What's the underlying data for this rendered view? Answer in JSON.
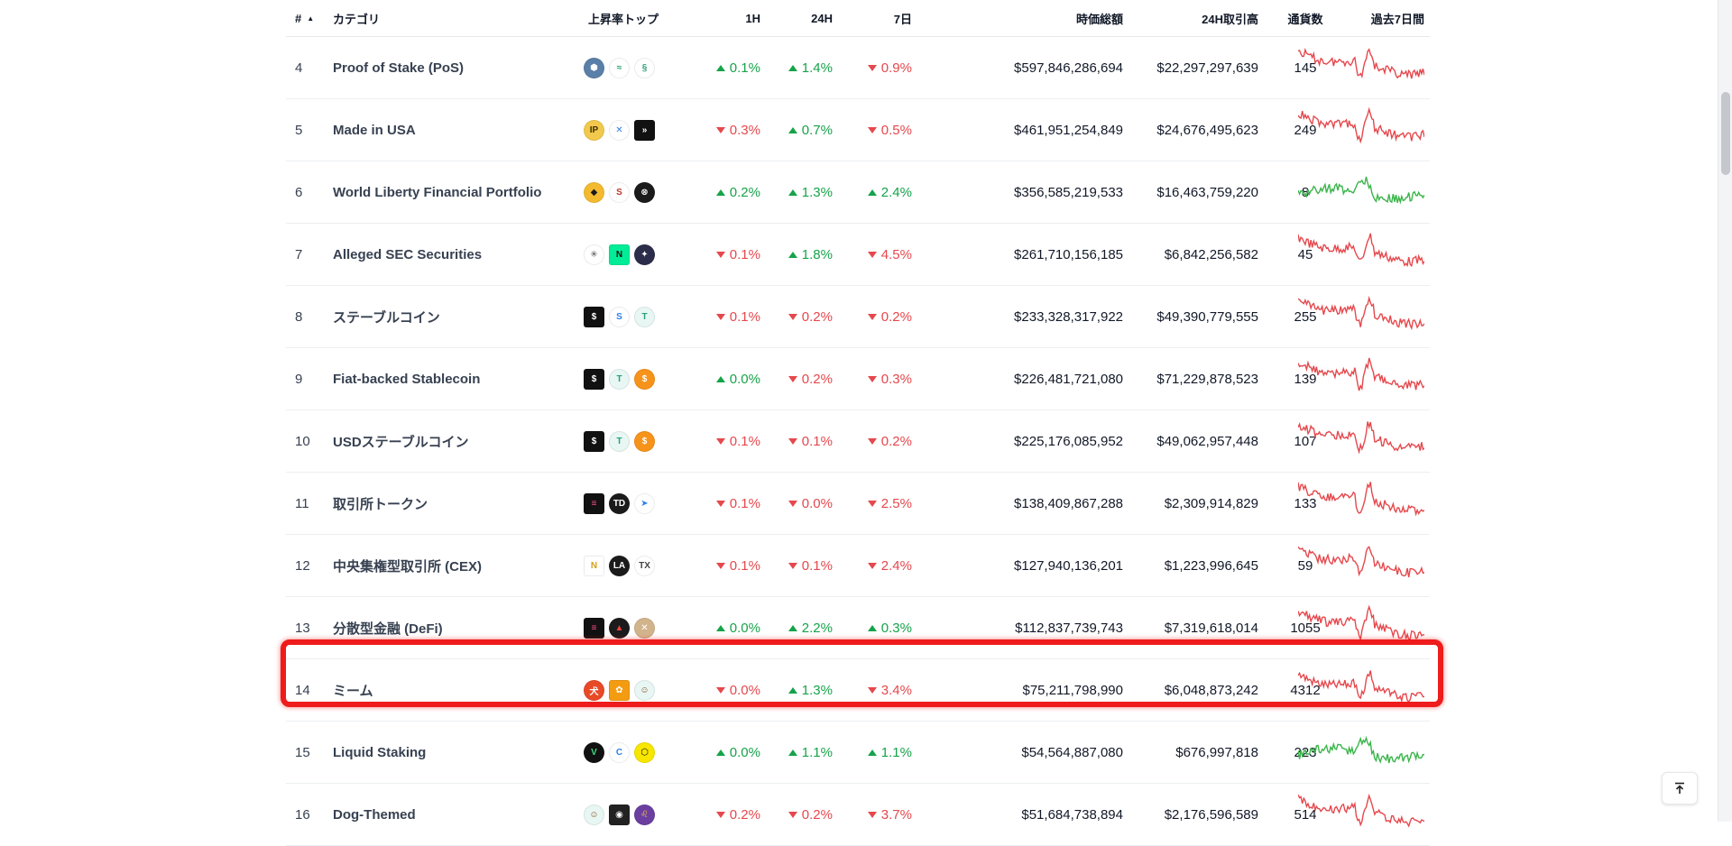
{
  "header": {
    "rank": "#",
    "category": "カテゴリ",
    "top_gainers": "上昇率トップ",
    "h1": "1H",
    "h24": "24H",
    "d7": "7日",
    "market_cap": "時価総額",
    "volume_24h": "24H取引高",
    "coin_count": "通貨数",
    "last_7d": "過去7日間"
  },
  "colors": {
    "up": "#16a34a",
    "down": "#e5484d",
    "highlight": "#ee1c1c"
  },
  "rows": [
    {
      "rank": "4",
      "name": "Proof of Stake (PoS)",
      "h1": "0.1%",
      "h1_dir": "up",
      "h24": "1.4%",
      "h24_dir": "up",
      "d7": "0.9%",
      "d7_dir": "down",
      "mcap": "$597,846,286,694",
      "vol": "$22,297,297,639",
      "count": "145",
      "trend": "down",
      "icons": [
        {
          "name": "cosmos-hub-icon",
          "bg": "#5a7fa8",
          "fg": "#fff",
          "g": "⬢",
          "sq": false
        },
        {
          "name": "leaf-token-icon",
          "bg": "#ffffff",
          "fg": "#22a36c",
          "g": "≈",
          "sq": false
        },
        {
          "name": "link-token-icon",
          "bg": "#ffffff",
          "fg": "#2f9e7a",
          "g": "§",
          "sq": false
        }
      ]
    },
    {
      "rank": "5",
      "name": "Made in USA",
      "h1": "0.3%",
      "h1_dir": "down",
      "h24": "0.7%",
      "h24_dir": "up",
      "d7": "0.5%",
      "d7_dir": "down",
      "mcap": "$461,951,254,849",
      "vol": "$24,676,495,623",
      "count": "249",
      "trend": "down",
      "icons": [
        {
          "name": "ip-token-icon",
          "bg": "#f2c94c",
          "fg": "#3b2f00",
          "g": "IP",
          "sq": false
        },
        {
          "name": "x-token-icon",
          "bg": "#ffffff",
          "fg": "#2f80ed",
          "g": "✕",
          "sq": false
        },
        {
          "name": "arrow-token-icon",
          "bg": "#111111",
          "fg": "#ffffff",
          "g": "»",
          "sq": true
        }
      ]
    },
    {
      "rank": "6",
      "name": "World Liberty Financial Portfolio",
      "h1": "0.2%",
      "h1_dir": "up",
      "h24": "1.3%",
      "h24_dir": "up",
      "d7": "2.4%",
      "d7_dir": "up",
      "mcap": "$356,585,219,533",
      "vol": "$16,463,759,220",
      "count": "8",
      "trend": "up",
      "icons": [
        {
          "name": "bnb-token-icon",
          "bg": "#f3ba2f",
          "fg": "#1a1a1a",
          "g": "◆",
          "sq": false
        },
        {
          "name": "red-swirl-token-icon",
          "bg": "#ffffff",
          "fg": "#c0392b",
          "g": "S",
          "sq": false
        },
        {
          "name": "dark-token-icon",
          "bg": "#1b1b1b",
          "fg": "#ffffff",
          "g": "⊗",
          "sq": false
        }
      ]
    },
    {
      "rank": "7",
      "name": "Alleged SEC Securities",
      "h1": "0.1%",
      "h1_dir": "down",
      "h24": "1.8%",
      "h24_dir": "up",
      "d7": "4.5%",
      "d7_dir": "down",
      "mcap": "$261,710,156,185",
      "vol": "$6,842,256,582",
      "count": "45",
      "trend": "down",
      "icons": [
        {
          "name": "x-pattern-token-icon",
          "bg": "#ffffff",
          "fg": "#555555",
          "g": "✳",
          "sq": false
        },
        {
          "name": "near-token-icon",
          "bg": "#00ec97",
          "fg": "#111111",
          "g": "N",
          "sq": true
        },
        {
          "name": "star-token-icon",
          "bg": "#2b2d4a",
          "fg": "#ffffff",
          "g": "✦",
          "sq": false
        }
      ]
    },
    {
      "rank": "8",
      "name": "ステーブルコイン",
      "h1": "0.1%",
      "h1_dir": "down",
      "h24": "0.2%",
      "h24_dir": "down",
      "d7": "0.2%",
      "d7_dir": "down",
      "mcap": "$233,328,317,922",
      "vol": "$49,390,779,555",
      "count": "255",
      "trend": "down",
      "icons": [
        {
          "name": "dollar-square-token-icon",
          "bg": "#111111",
          "fg": "#ffffff",
          "g": "$",
          "sq": true
        },
        {
          "name": "usd-swirl-token-icon",
          "bg": "#ffffff",
          "fg": "#2f80ed",
          "g": "S",
          "sq": false
        },
        {
          "name": "usdt-token-icon",
          "bg": "#e8f7f3",
          "fg": "#26a17b",
          "g": "T",
          "sq": false
        }
      ]
    },
    {
      "rank": "9",
      "name": "Fiat-backed Stablecoin",
      "h1": "0.0%",
      "h1_dir": "up",
      "h24": "0.2%",
      "h24_dir": "down",
      "d7": "0.3%",
      "d7_dir": "down",
      "mcap": "$226,481,721,080",
      "vol": "$71,229,878,523",
      "count": "139",
      "trend": "down",
      "icons": [
        {
          "name": "dollar-square-token-icon",
          "bg": "#111111",
          "fg": "#ffffff",
          "g": "$",
          "sq": true
        },
        {
          "name": "usdt-token-icon",
          "bg": "#e8f7f3",
          "fg": "#26a17b",
          "g": "T",
          "sq": false
        },
        {
          "name": "orange-dollar-token-icon",
          "bg": "#f7931a",
          "fg": "#ffffff",
          "g": "$",
          "sq": false
        }
      ]
    },
    {
      "rank": "10",
      "name": "USDステーブルコイン",
      "h1": "0.1%",
      "h1_dir": "down",
      "h24": "0.1%",
      "h24_dir": "down",
      "d7": "0.2%",
      "d7_dir": "down",
      "mcap": "$225,176,085,952",
      "vol": "$49,062,957,448",
      "count": "107",
      "trend": "down",
      "icons": [
        {
          "name": "dollar-square-token-icon",
          "bg": "#111111",
          "fg": "#ffffff",
          "g": "$",
          "sq": true
        },
        {
          "name": "usdt-token-icon",
          "bg": "#e8f7f3",
          "fg": "#26a17b",
          "g": "T",
          "sq": false
        },
        {
          "name": "orange-dollar-token-icon",
          "bg": "#f7931a",
          "fg": "#ffffff",
          "g": "$",
          "sq": false
        }
      ]
    },
    {
      "rank": "11",
      "name": "取引所トークン",
      "h1": "0.1%",
      "h1_dir": "down",
      "h24": "0.0%",
      "h24_dir": "down",
      "d7": "2.5%",
      "d7_dir": "down",
      "mcap": "$138,409,867,288",
      "vol": "$2,309,914,829",
      "count": "133",
      "trend": "down",
      "icons": [
        {
          "name": "stripes-token-icon",
          "bg": "#111111",
          "fg": "#ff4d8d",
          "g": "≡",
          "sq": true
        },
        {
          "name": "td-token-icon",
          "bg": "#1b1b1b",
          "fg": "#ffffff",
          "g": "TD",
          "sq": false
        },
        {
          "name": "paper-plane-token-icon",
          "bg": "#ffffff",
          "fg": "#2f80ed",
          "g": "➤",
          "sq": false
        }
      ]
    },
    {
      "rank": "12",
      "name": "中央集権型取引所 (CEX)",
      "h1": "0.1%",
      "h1_dir": "down",
      "h24": "0.1%",
      "h24_dir": "down",
      "d7": "2.4%",
      "d7_dir": "down",
      "mcap": "$127,940,136,201",
      "vol": "$1,223,996,645",
      "count": "59",
      "trend": "down",
      "icons": [
        {
          "name": "gold-n-token-icon",
          "bg": "#ffffff",
          "fg": "#d4a017",
          "g": "N",
          "sq": true
        },
        {
          "name": "la-token-icon",
          "bg": "#1b1b1b",
          "fg": "#ffffff",
          "g": "LA",
          "sq": false
        },
        {
          "name": "tx24-token-icon",
          "bg": "#ffffff",
          "fg": "#444444",
          "g": "TX",
          "sq": false
        }
      ]
    },
    {
      "rank": "13",
      "name": "分散型金融 (DeFi)",
      "h1": "0.0%",
      "h1_dir": "up",
      "h24": "2.2%",
      "h24_dir": "up",
      "d7": "0.3%",
      "d7_dir": "up",
      "mcap": "$112,837,739,743",
      "vol": "$7,319,618,014",
      "count": "1055",
      "trend": "down",
      "icons": [
        {
          "name": "stripes-token-icon",
          "bg": "#111111",
          "fg": "#ff4d8d",
          "g": "≡",
          "sq": true
        },
        {
          "name": "avalanche-token-icon",
          "bg": "#1b1b1b",
          "fg": "#e84142",
          "g": "▲",
          "sq": false
        },
        {
          "name": "tan-token-icon",
          "bg": "#d2b48c",
          "fg": "#ffffff",
          "g": "✕",
          "sq": false
        }
      ]
    },
    {
      "rank": "14",
      "name": "ミーム",
      "h1": "0.0%",
      "h1_dir": "down",
      "h24": "1.3%",
      "h24_dir": "up",
      "d7": "3.4%",
      "d7_dir": "down",
      "mcap": "$75,211,798,990",
      "vol": "$6,048,873,242",
      "count": "4312",
      "trend": "down",
      "highlight": true,
      "icons": [
        {
          "name": "shiba-inu-token-icon",
          "bg": "#e84a27",
          "fg": "#ffffff",
          "g": "犬",
          "sq": false
        },
        {
          "name": "orange-meme-token-icon",
          "bg": "#f39c12",
          "fg": "#ffffff",
          "g": "✿",
          "sq": true
        },
        {
          "name": "doge-face-token-icon",
          "bg": "#e8f7f3",
          "fg": "#8b4513",
          "g": "☺",
          "sq": false
        }
      ]
    },
    {
      "rank": "15",
      "name": "Liquid Staking",
      "h1": "0.0%",
      "h1_dir": "up",
      "h24": "1.1%",
      "h24_dir": "up",
      "d7": "1.1%",
      "d7_dir": "up",
      "mcap": "$54,564,887,080",
      "vol": "$676,997,818",
      "count": "223",
      "trend": "up",
      "icons": [
        {
          "name": "green-v-token-icon",
          "bg": "#111111",
          "fg": "#3ddc84",
          "g": "V",
          "sq": false
        },
        {
          "name": "blue-c-token-icon",
          "bg": "#ffffff",
          "fg": "#2f80ed",
          "g": "C",
          "sq": false
        },
        {
          "name": "yellow-hex-token-icon",
          "bg": "#f7e600",
          "fg": "#111111",
          "g": "⬡",
          "sq": false
        }
      ]
    },
    {
      "rank": "16",
      "name": "Dog-Themed",
      "h1": "0.2%",
      "h1_dir": "down",
      "h24": "0.2%",
      "h24_dir": "down",
      "d7": "3.7%",
      "d7_dir": "down",
      "mcap": "$51,684,738,894",
      "vol": "$2,176,596,589",
      "count": "514",
      "trend": "down",
      "icons": [
        {
          "name": "doge-face-token-icon",
          "bg": "#e8f7f3",
          "fg": "#8b4513",
          "g": "☺",
          "sq": false
        },
        {
          "name": "dark-dog-token-icon",
          "bg": "#222222",
          "fg": "#ffffff",
          "g": "◉",
          "sq": true
        },
        {
          "name": "lion-token-icon",
          "bg": "#6b3fa0",
          "fg": "#f5c542",
          "g": "♌",
          "sq": false
        }
      ]
    }
  ],
  "back_to_top": {
    "icon": "arrow-up-to-line-icon"
  }
}
